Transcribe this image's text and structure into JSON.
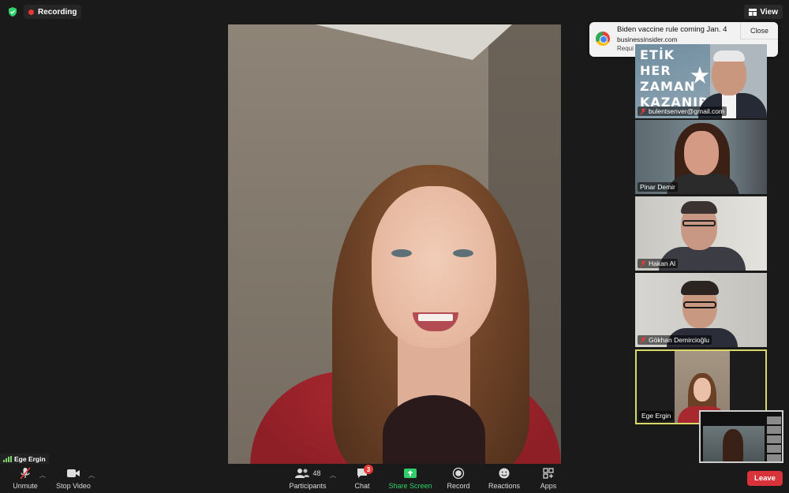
{
  "topbar": {
    "recording_label": "Recording",
    "view_label": "View",
    "colors": {
      "recording_dot": "#e53935",
      "shield": "#2fd06a"
    }
  },
  "notification": {
    "title": "Biden vaccine rule coming Jan. 4",
    "source": "businessinsider.com",
    "more": "Requi",
    "close_label": "Close",
    "icon": "chrome-icon"
  },
  "gallery": [
    {
      "name": "bulentsenver@gmail.com",
      "muted": true,
      "poster_words": [
        "ETİK",
        "HER",
        "ZAMAN",
        "KAZANIR"
      ]
    },
    {
      "name": "Pinar Demir",
      "muted": false
    },
    {
      "name": "Hakan Al",
      "muted": true
    },
    {
      "name": "Gökhan Demircioğlu",
      "muted": true
    },
    {
      "name": "Ege Ergin",
      "muted": false,
      "active_speaker": true
    }
  ],
  "self_view": {
    "name": "Ege Ergin"
  },
  "toolbar": {
    "unmute_label": "Unmute",
    "stop_video_label": "Stop Video",
    "participants_label": "Participants",
    "participants_count": "48",
    "chat_label": "Chat",
    "chat_badge": "3",
    "share_screen_label": "Share Screen",
    "record_label": "Record",
    "reactions_label": "Reactions",
    "apps_label": "Apps",
    "leave_label": "Leave",
    "colors": {
      "share": "#2fd06a",
      "leave": "#d8333b",
      "badge": "#e53935"
    }
  }
}
